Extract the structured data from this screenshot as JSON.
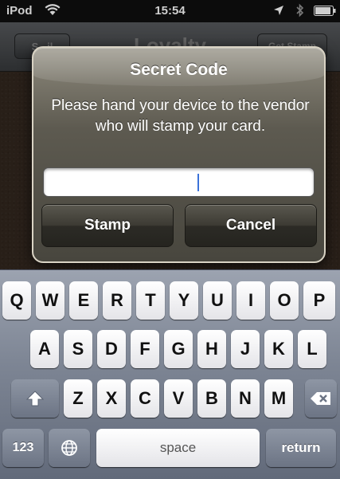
{
  "status_bar": {
    "carrier": "iPod",
    "time": "15:54",
    "icons": [
      "wifi-icon",
      "location-icon",
      "bluetooth-icon",
      "battery-icon"
    ]
  },
  "nav_bar": {
    "back_label": "S...il",
    "title": "Loyalty",
    "right_label": "Get Stamp"
  },
  "alert": {
    "title": "Secret Code",
    "message": "Please hand your device to the vendor who will stamp your card.",
    "input_value": "",
    "stamp_label": "Stamp",
    "cancel_label": "Cancel"
  },
  "keyboard": {
    "row1": [
      "Q",
      "W",
      "E",
      "R",
      "T",
      "Y",
      "U",
      "I",
      "O",
      "P"
    ],
    "row2": [
      "A",
      "S",
      "D",
      "F",
      "G",
      "H",
      "J",
      "K",
      "L"
    ],
    "row3": [
      "Z",
      "X",
      "C",
      "V",
      "B",
      "N",
      "M"
    ],
    "numbers_label": "123",
    "space_label": "space",
    "return_label": "return",
    "shift_icon": "shift-arrow-icon",
    "globe_icon": "globe-icon",
    "delete_icon": "backspace-icon"
  },
  "colors": {
    "alert_top": "#8e8a7d",
    "alert_bottom": "#48463e",
    "keyboard_bg": "#7d8594",
    "cursor": "#3b72d9"
  }
}
